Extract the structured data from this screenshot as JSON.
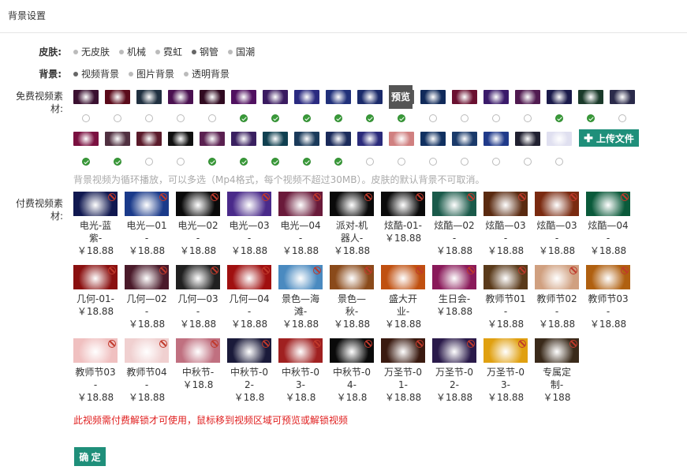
{
  "panel_title": "背景设置",
  "skin": {
    "label": "皮肤:",
    "options": [
      "无皮肤",
      "机械",
      "霓虹",
      "钢管",
      "国潮"
    ],
    "selected_index": 3
  },
  "background": {
    "label": "背景:",
    "options": [
      "视频背景",
      "图片背景",
      "透明背景"
    ],
    "selected_index": 0
  },
  "free_section": {
    "label": "免费视频素材:",
    "preview_label": "预览",
    "upload_label": "上传文件",
    "row1_colors": [
      "#3a1030",
      "#5a0a1a",
      "#203040",
      "#4a1050",
      "#300a20",
      "#501060",
      "#3a1a60",
      "#2a2a80",
      "#20307a",
      "#1a2a6a",
      "#5a5a5a",
      "#102a5a",
      "#6a1030",
      "#3a1a6a",
      "#501a50",
      "#1a1a4a",
      "#1a3a2a",
      "#2a2a4a"
    ],
    "row1_checked": [
      false,
      false,
      false,
      false,
      false,
      true,
      true,
      true,
      true,
      true,
      true,
      false,
      false,
      false,
      false,
      true,
      true,
      false
    ],
    "row2_colors": [
      "#7a1040",
      "#503040",
      "#5a1a2a",
      "#101010",
      "#5a2050",
      "#3a2060",
      "#104050",
      "#1a3a5a",
      "#1a2a5a",
      "#2a2a7a",
      "#d08080",
      "#103060",
      "#1a3a6a",
      "#203a8a",
      "#202030",
      "#e0e0f0"
    ],
    "row2_checked": [
      true,
      true,
      false,
      false,
      true,
      true,
      true,
      true,
      true,
      false,
      false,
      false,
      false,
      false,
      false,
      false
    ],
    "hint": "背景视频为循环播放，可以多选（Mp4格式，每个视频不超过30MB）。皮肤的默认背景不可取消。"
  },
  "paid_section": {
    "label": "付费视频素材:",
    "items": [
      {
        "name": "电光-蓝紫-",
        "price": "￥18.88",
        "color": "#101850"
      },
      {
        "name": "电光—01-",
        "price": "￥18.88",
        "color": "#1a3a8a"
      },
      {
        "name": "电光—02-",
        "price": "￥18.88",
        "color": "#0a0a0a"
      },
      {
        "name": "电光—03-",
        "price": "￥18.88",
        "color": "#4a2a8a"
      },
      {
        "name": "电光—04-",
        "price": "￥18.88",
        "color": "#6a1a3a"
      },
      {
        "name": "派对-机器人-",
        "price": "￥18.88",
        "color": "#0a0a0a"
      },
      {
        "name": "炫酷-01-",
        "price": "￥18.88",
        "color": "#0a0a0a"
      },
      {
        "name": "炫酷—02-",
        "price": "￥18.88",
        "color": "#1a5a4a"
      },
      {
        "name": "炫酷—03-",
        "price": "￥18.88",
        "color": "#5a2a10"
      },
      {
        "name": "炫酷—03-",
        "price": "￥18.88",
        "color": "#7a2a10"
      },
      {
        "name": "炫酷—04-",
        "price": "￥18.88",
        "color": "#0a5a3a"
      },
      {
        "name": "几何-01-",
        "price": "￥18.88",
        "color": "#8a1010"
      },
      {
        "name": "几何—02-",
        "price": "￥18.88",
        "color": "#4a1a2a"
      },
      {
        "name": "几何—03-",
        "price": "￥18.88",
        "color": "#202020"
      },
      {
        "name": "几何—04-",
        "price": "￥18.88",
        "color": "#a01010"
      },
      {
        "name": "景色—海滩-",
        "price": "￥18.88",
        "color": "#4a8ac0"
      },
      {
        "name": "景色—秋-",
        "price": "￥18.88",
        "color": "#8a4a1a"
      },
      {
        "name": "盛大开业-",
        "price": "￥18.88",
        "color": "#c05010"
      },
      {
        "name": "生日会-",
        "price": "￥18.88",
        "color": "#8a1a5a"
      },
      {
        "name": "教师节01-",
        "price": "￥18.88",
        "color": "#5a3a1a"
      },
      {
        "name": "教师节02-",
        "price": "￥18.88",
        "color": "#d0a080"
      },
      {
        "name": "教师节03-",
        "price": "￥18.88",
        "color": "#b06010"
      },
      {
        "name": "教师节03-",
        "price": "￥18.88",
        "color": "#f0c0c0"
      },
      {
        "name": "教师节04-",
        "price": "￥18.88",
        "color": "#f0d0d0"
      },
      {
        "name": "中秋节-",
        "price": "￥18.8",
        "color": "#c07080"
      },
      {
        "name": "中秋节-02-",
        "price": "￥18.8",
        "color": "#1a1a3a"
      },
      {
        "name": "中秋节-03-",
        "price": "￥18.8",
        "color": "#a02020"
      },
      {
        "name": "中秋节-04-",
        "price": "￥18.8",
        "color": "#0a0a0a"
      },
      {
        "name": "万圣节-01-",
        "price": "￥18.88",
        "color": "#3a1a10"
      },
      {
        "name": "万圣节-02-",
        "price": "￥18.88",
        "color": "#2a1a4a"
      },
      {
        "name": "万圣节-03-",
        "price": "￥18.88",
        "color": "#e0a010"
      },
      {
        "name": "专属定制-",
        "price": "￥188",
        "color": "#3a2a1a"
      }
    ]
  },
  "warning": "此视频需付费解锁才可使用，鼠标移到视频区域可预览或解锁视频",
  "confirm_label": "确 定"
}
